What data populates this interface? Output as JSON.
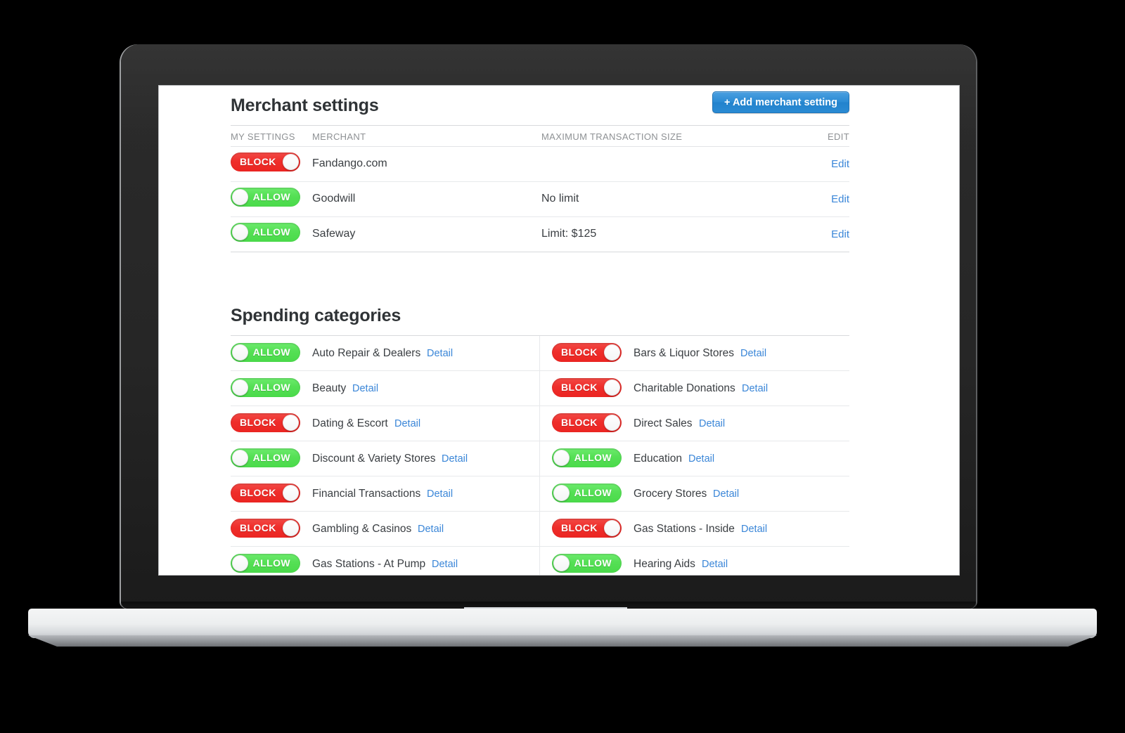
{
  "merchant_section": {
    "title": "Merchant settings",
    "add_button": "+ Add merchant setting",
    "columns": {
      "my_settings": "MY SETTINGS",
      "merchant": "MERCHANT",
      "max_transaction_size": "MAXIMUM TRANSACTION SIZE",
      "edit": "EDIT"
    },
    "rows": [
      {
        "state": "BLOCK",
        "name": "Fandango.com",
        "limit": "",
        "edit": "Edit"
      },
      {
        "state": "ALLOW",
        "name": "Goodwill",
        "limit": "No limit",
        "edit": "Edit"
      },
      {
        "state": "ALLOW",
        "name": "Safeway",
        "limit": "Limit: $125",
        "edit": "Edit"
      }
    ]
  },
  "categories_section": {
    "title": "Spending categories",
    "detail_label": "Detail",
    "rows": [
      {
        "left": {
          "state": "ALLOW",
          "name": "Auto Repair & Dealers",
          "detail": "Detail"
        },
        "right": {
          "state": "BLOCK",
          "name": "Bars & Liquor Stores",
          "detail": "Detail"
        }
      },
      {
        "left": {
          "state": "ALLOW",
          "name": "Beauty",
          "detail": "Detail"
        },
        "right": {
          "state": "BLOCK",
          "name": "Charitable Donations",
          "detail": "Detail"
        }
      },
      {
        "left": {
          "state": "BLOCK",
          "name": "Dating & Escort",
          "detail": "Detail"
        },
        "right": {
          "state": "BLOCK",
          "name": "Direct Sales",
          "detail": "Detail"
        }
      },
      {
        "left": {
          "state": "ALLOW",
          "name": "Discount & Variety Stores",
          "detail": "Detail"
        },
        "right": {
          "state": "ALLOW",
          "name": "Education",
          "detail": "Detail"
        }
      },
      {
        "left": {
          "state": "BLOCK",
          "name": "Financial Transactions",
          "detail": "Detail"
        },
        "right": {
          "state": "ALLOW",
          "name": "Grocery Stores",
          "detail": "Detail"
        }
      },
      {
        "left": {
          "state": "BLOCK",
          "name": "Gambling & Casinos",
          "detail": "Detail"
        },
        "right": {
          "state": "BLOCK",
          "name": "Gas Stations - Inside",
          "detail": "Detail"
        }
      },
      {
        "left": {
          "state": "ALLOW",
          "name": "Gas Stations - At Pump",
          "detail": "Detail"
        },
        "right": {
          "state": "ALLOW",
          "name": "Hearing Aids",
          "detail": "Detail"
        }
      }
    ]
  },
  "colors": {
    "block": "#ef2e2b",
    "allow": "#55e055",
    "link": "#3a86d8",
    "button": "#2b8bd4",
    "heading": "#2f3336",
    "header_text": "#8e9194"
  }
}
